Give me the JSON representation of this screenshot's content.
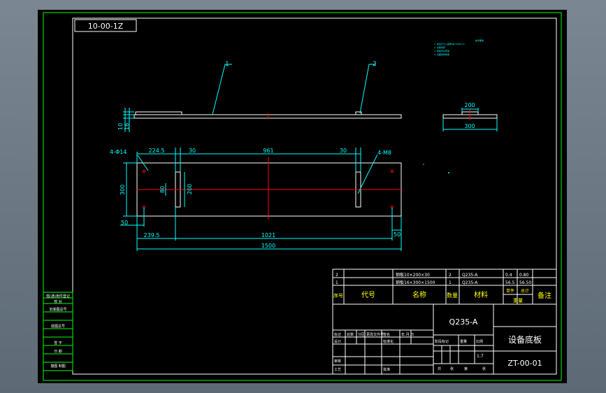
{
  "colors": {
    "background": "#000000",
    "border": "#00ff00",
    "drawing": "#ffffff",
    "dimension": "#00ffff",
    "centerline": "#ff0000",
    "table_header": "#ffff00"
  },
  "top_code": "10-00-1Z",
  "leaders": {
    "part1": "1",
    "part2": "2"
  },
  "notes_title": "技术要求",
  "notes": [
    "1. 未注尺寸公差按GB/T1804-m",
    "2. 去除毛刺",
    "3. 焊缝均匀牢固",
    "4. 表面涂防锈漆"
  ],
  "front_view": {
    "dim_thick_a": "10",
    "dim_thick_b": "16"
  },
  "side_view": {
    "dim_top": "200",
    "dim_bottom": "300"
  },
  "plan_view": {
    "hole_left": "4-Φ14",
    "hole_right": "4-M8",
    "dim_2245": "224.5",
    "dim_30a": "30",
    "dim_961": "961",
    "dim_30b": "30",
    "dim_300_left": "300",
    "dim_80": "80",
    "dim_200_plate": "200",
    "dim_50_left": "50",
    "dim_2395": "239.5",
    "dim_1021": "1021",
    "dim_1500": "1500",
    "dim_50_right": "50"
  },
  "left_stamp": [
    "借(通)用件登记",
    "旧底图总号",
    "底图总号",
    "签 字",
    "日 期",
    "描图 制图",
    "校 对"
  ],
  "bom": {
    "rows": [
      {
        "no": "2",
        "code": "",
        "name": "钢板10×200×30",
        "qty": "2",
        "material": "Q235-A",
        "unit_weight": "0.4",
        "total_weight": "0.80",
        "remark": ""
      },
      {
        "no": "1",
        "code": "",
        "name": "钢板16×300×1500",
        "qty": "1",
        "material": "Q235-A",
        "unit_weight": "56.5",
        "total_weight": "56.50",
        "remark": ""
      }
    ],
    "headers": {
      "no": "序号",
      "code": "代号",
      "name": "名称",
      "qty": "数量",
      "material": "材料",
      "single": "单件",
      "total": "总计",
      "weight": "重量",
      "remark": "备注"
    }
  },
  "title_block": {
    "material": "Q235-A",
    "drawing_title": "设备底板",
    "drawing_number": "ZT-00-01",
    "labels": {
      "mark": "标记",
      "count": "处数",
      "zone": "分区",
      "change_doc": "更改文件号",
      "sign": "签名",
      "date": "年.月.日",
      "design": "设计",
      "standardize": "标准化",
      "stage_mark": "阶段标记",
      "weight": "重量",
      "scale": "比例",
      "review": "审核",
      "process": "工艺",
      "approve": "批准",
      "sheets_total": "共",
      "sheet_unit": "张",
      "sheet_no": "第",
      "sheet_unit2": "张"
    },
    "scale_value": "1:7"
  }
}
